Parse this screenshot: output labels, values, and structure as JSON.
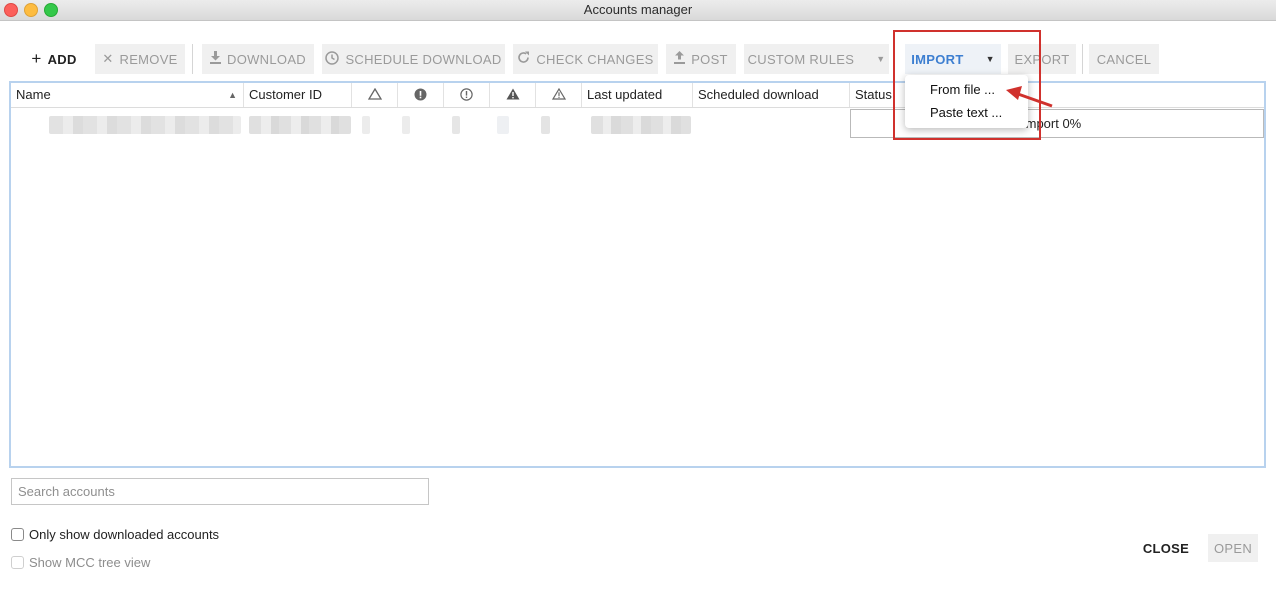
{
  "window": {
    "title": "Accounts manager"
  },
  "toolbar": {
    "add": "ADD",
    "remove": "REMOVE",
    "download": "DOWNLOAD",
    "schedule_download": "SCHEDULE DOWNLOAD",
    "check_changes": "CHECK CHANGES",
    "post": "POST",
    "custom_rules": "CUSTOM RULES",
    "import": "IMPORT",
    "export": "EXPORT",
    "cancel": "CANCEL"
  },
  "icons": {
    "add": "plus-icon",
    "remove": "close-icon",
    "download": "download-icon",
    "schedule": "clock-icon",
    "check_changes": "refresh-icon",
    "post": "upload-icon",
    "dropdown": "caret-down-icon",
    "warning": "warning-outline-icon",
    "error": "error-filled-icon",
    "info": "alert-outline-icon",
    "warning_filled": "warning-filled-icon",
    "sort": "sort-ascending-icon"
  },
  "import_menu": {
    "items": [
      "From file ...",
      "Paste text ..."
    ]
  },
  "table": {
    "columns": {
      "name": "Name",
      "customer_id": "Customer ID",
      "last_updated": "Last updated",
      "scheduled_download": "Scheduled download",
      "status": "Status"
    },
    "row_status": "Import  0%"
  },
  "search": {
    "placeholder": "Search accounts",
    "value": ""
  },
  "options": {
    "only_downloaded": {
      "label": "Only show downloaded accounts",
      "checked": false
    },
    "mcc_tree": {
      "label": "Show MCC tree view",
      "checked": false,
      "disabled": true
    }
  },
  "footer": {
    "close": "CLOSE",
    "open": "OPEN"
  },
  "colors": {
    "accent": "#3d7fd1",
    "highlight": "#d0312d",
    "selection_border": "#b8d2ee"
  }
}
